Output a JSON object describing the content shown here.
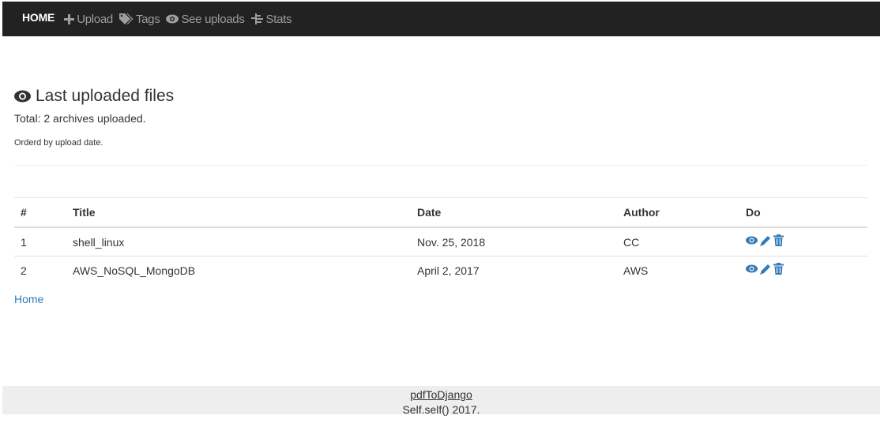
{
  "navbar": {
    "brand": "HOME",
    "items": [
      {
        "label": "Upload",
        "icon": "plus-icon"
      },
      {
        "label": "Tags",
        "icon": "tags-icon"
      },
      {
        "label": "See uploads",
        "icon": "eye-icon"
      },
      {
        "label": "Stats",
        "icon": "stats-icon"
      }
    ]
  },
  "main": {
    "title": "Last uploaded files",
    "total": "Total: 2 archives uploaded.",
    "order_note": "Orderd by upload date.",
    "table": {
      "headers": [
        "#",
        "Title",
        "Date",
        "Author",
        "Do"
      ],
      "rows": [
        {
          "num": "1",
          "title": "shell_linux",
          "date": "Nov. 25, 2018",
          "author": "CC"
        },
        {
          "num": "2",
          "title": "AWS_NoSQL_MongoDB",
          "date": "April 2, 2017",
          "author": "AWS"
        }
      ]
    },
    "home_link": "Home"
  },
  "footer": {
    "link": "pdfToDjango",
    "copyright": "Self.self() 2017."
  },
  "colors": {
    "navbar_bg": "#222222",
    "nav_text": "#9d9d9d",
    "link": "#337ab7",
    "footer_bg": "#eeeeee"
  }
}
